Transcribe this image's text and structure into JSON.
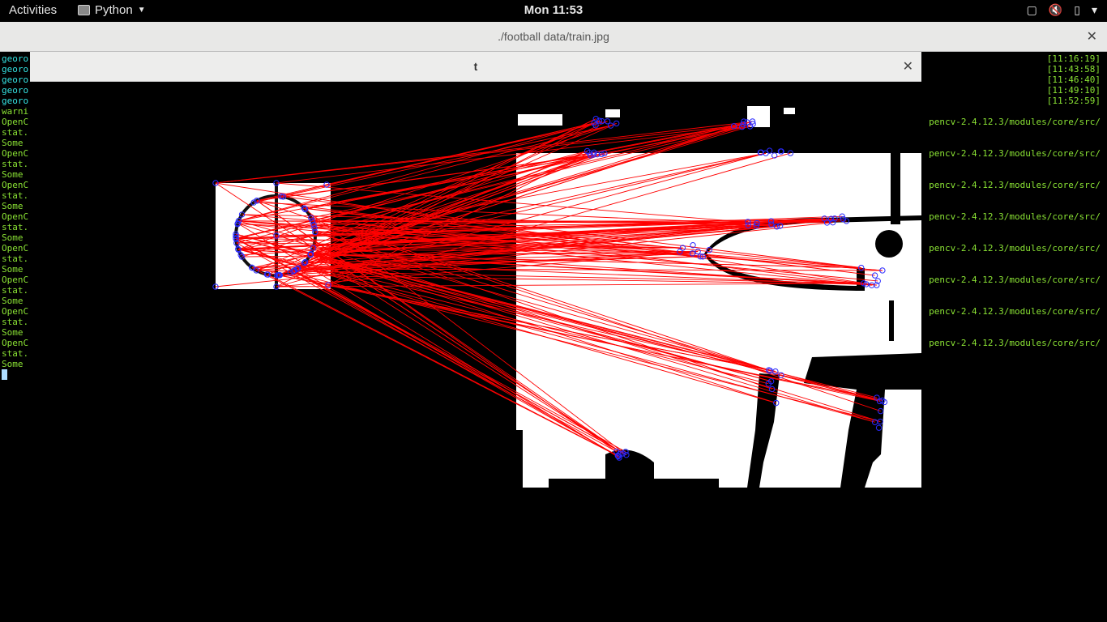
{
  "topbar": {
    "activities": "Activities",
    "app_name": "Python",
    "clock": "Mon 11:53",
    "tray_icons": [
      "window-icon",
      "volume-muted-icon",
      "battery-icon",
      "chevron-down-icon"
    ]
  },
  "terminal": {
    "title": "./football data/train.jpg",
    "left_lines": [
      {
        "text": "georo",
        "color": "cyan"
      },
      {
        "text": "georo",
        "color": "cyan"
      },
      {
        "text": "georo",
        "color": "cyan"
      },
      {
        "text": "georo",
        "color": "cyan"
      },
      {
        "text": "georo",
        "color": "cyan"
      },
      {
        "text": "warni",
        "color": "green"
      },
      {
        "text": "OpenC",
        "color": "green"
      },
      {
        "text": "stat.",
        "color": "green"
      },
      {
        "text": "Some",
        "color": "green"
      },
      {
        "text": "OpenC",
        "color": "green"
      },
      {
        "text": "stat.",
        "color": "green"
      },
      {
        "text": "Some",
        "color": "green"
      },
      {
        "text": "OpenC",
        "color": "green"
      },
      {
        "text": "stat.",
        "color": "green"
      },
      {
        "text": "Some",
        "color": "green"
      },
      {
        "text": "OpenC",
        "color": "green"
      },
      {
        "text": "stat.",
        "color": "green"
      },
      {
        "text": "Some",
        "color": "green"
      },
      {
        "text": "OpenC",
        "color": "green"
      },
      {
        "text": "stat.",
        "color": "green"
      },
      {
        "text": "Some",
        "color": "green"
      },
      {
        "text": "OpenC",
        "color": "green"
      },
      {
        "text": "stat.",
        "color": "green"
      },
      {
        "text": "Some",
        "color": "green"
      },
      {
        "text": "OpenC",
        "color": "green"
      },
      {
        "text": "stat.",
        "color": "green"
      },
      {
        "text": "Some",
        "color": "green"
      },
      {
        "text": "OpenC",
        "color": "green"
      },
      {
        "text": "stat.",
        "color": "green"
      },
      {
        "text": "Some",
        "color": "green"
      }
    ],
    "right_lines": [
      {
        "text": "[11:16:19]",
        "color": "green"
      },
      {
        "text": "[11:43:58]",
        "color": "green"
      },
      {
        "text": "[11:46:40]",
        "color": "green"
      },
      {
        "text": "[11:49:10]",
        "color": "green"
      },
      {
        "text": "[11:52:59]",
        "color": "green"
      },
      {
        "text": "",
        "color": "green"
      },
      {
        "text": "pencv-2.4.12.3/modules/core/src/",
        "color": "green"
      },
      {
        "text": "",
        "color": "green"
      },
      {
        "text": "",
        "color": "green"
      },
      {
        "text": "pencv-2.4.12.3/modules/core/src/",
        "color": "green"
      },
      {
        "text": "",
        "color": "green"
      },
      {
        "text": "",
        "color": "green"
      },
      {
        "text": "pencv-2.4.12.3/modules/core/src/",
        "color": "green"
      },
      {
        "text": "",
        "color": "green"
      },
      {
        "text": "",
        "color": "green"
      },
      {
        "text": "pencv-2.4.12.3/modules/core/src/",
        "color": "green"
      },
      {
        "text": "",
        "color": "green"
      },
      {
        "text": "",
        "color": "green"
      },
      {
        "text": "pencv-2.4.12.3/modules/core/src/",
        "color": "green"
      },
      {
        "text": "",
        "color": "green"
      },
      {
        "text": "",
        "color": "green"
      },
      {
        "text": "pencv-2.4.12.3/modules/core/src/",
        "color": "green"
      },
      {
        "text": "",
        "color": "green"
      },
      {
        "text": "",
        "color": "green"
      },
      {
        "text": "pencv-2.4.12.3/modules/core/src/",
        "color": "green"
      },
      {
        "text": "",
        "color": "green"
      },
      {
        "text": "",
        "color": "green"
      },
      {
        "text": "pencv-2.4.12.3/modules/core/src/",
        "color": "green"
      }
    ]
  },
  "cv_window": {
    "title": "t"
  },
  "colors": {
    "match_line": "#ff0000",
    "keypoint": "#2a2aff",
    "term_cyan": "#34e2e2",
    "term_green": "#8ae234"
  }
}
